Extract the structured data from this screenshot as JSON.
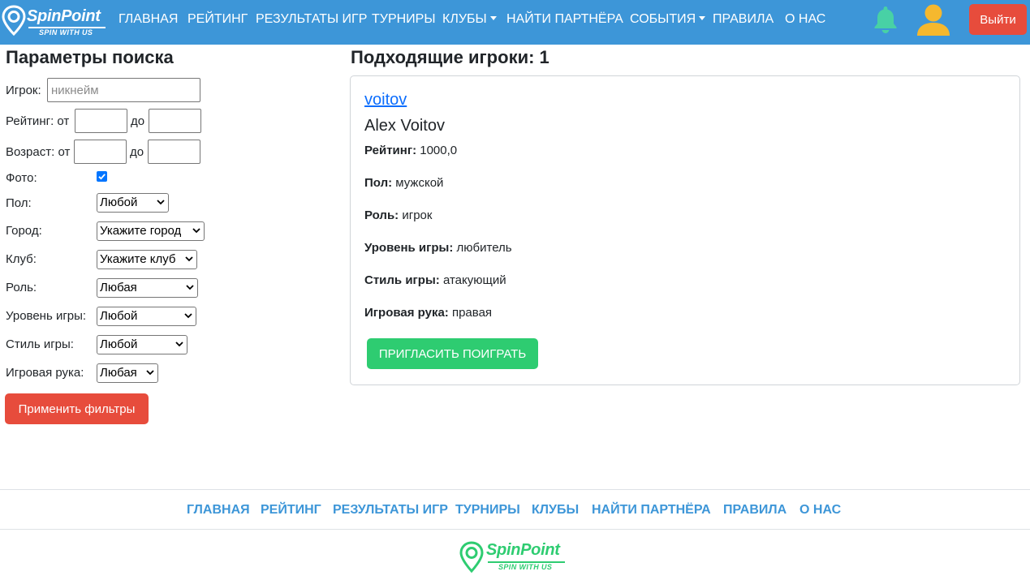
{
  "navbar": {
    "brand_name": "SpinPoint",
    "brand_tagline": "SPIN WITH US",
    "items": [
      {
        "label": "ГЛАВНАЯ"
      },
      {
        "label": "РЕЙТИНГ"
      },
      {
        "label": "РЕЗУЛЬТАТЫ ИГР"
      },
      {
        "label": "ТУРНИРЫ"
      },
      {
        "label": "КЛУБЫ"
      },
      {
        "label": "НАЙТИ ПАРТНЁРА"
      },
      {
        "label": "СОБЫТИЯ"
      },
      {
        "label": "ПРАВИЛА"
      },
      {
        "label": "О НАС"
      }
    ],
    "logout_label": "Выйти",
    "icons": {
      "notifications": "bell-icon",
      "profile": "user-avatar-icon"
    },
    "colors": {
      "background": "#3d96d8",
      "bell": "#48d1a5",
      "avatar": "#f5b82e",
      "logout": "#e74c3c"
    }
  },
  "filters": {
    "title": "Параметры поиска",
    "player_label": "Игрок:",
    "player_placeholder": "никнейм",
    "player_value": "",
    "rating_label": "Рейтинг: от",
    "rating_to_label": "до",
    "rating_from_value": "",
    "rating_to_value": "",
    "age_label": "Возраст: от",
    "age_to_label": "до",
    "age_from_value": "",
    "age_to_value": "",
    "photo_label": "Фото:",
    "photo_checked": true,
    "gender_label": "Пол:",
    "gender_value": "Любой",
    "city_label": "Город:",
    "city_value": "Укажите город",
    "club_label": "Клуб:",
    "club_value": "Укажите клуб",
    "role_label": "Роль:",
    "role_value": "Любая",
    "level_label": "Уровень игры:",
    "level_value": "Любой",
    "style_label": "Стиль игры:",
    "style_value": "Любой",
    "hand_label": "Игровая рука:",
    "hand_value": "Любая",
    "apply_label": "Применить фильтры"
  },
  "results": {
    "title": "Подходящие игроки: 1",
    "players": [
      {
        "username": "voitov",
        "full_name": "Alex Voitov",
        "rating_label": "Рейтинг:",
        "rating": "1000,0",
        "gender_label": "Пол:",
        "gender": "мужской",
        "role_label": "Роль:",
        "role": "игрок",
        "level_label": "Уровень игры:",
        "level": "любитель",
        "style_label": "Стиль игры:",
        "style": "атакующий",
        "hand_label": "Игровая рука:",
        "hand": "правая",
        "invite_label": "ПРИГЛАСИТЬ ПОИГРАТЬ"
      }
    ],
    "colors": {
      "invite": "#2ecc71",
      "username_link": "#0d6efd"
    }
  },
  "footer": {
    "links": [
      {
        "label": "ГЛАВНАЯ"
      },
      {
        "label": "РЕЙТИНГ"
      },
      {
        "label": "РЕЗУЛЬТАТЫ ИГР"
      },
      {
        "label": "ТУРНИРЫ"
      },
      {
        "label": "КЛУБЫ"
      },
      {
        "label": "НАЙТИ ПАРТНЁРА"
      },
      {
        "label": "ПРАВИЛА"
      },
      {
        "label": "О НАС"
      }
    ],
    "brand_name": "SpinPoint",
    "brand_tagline": "SPIN WITH US",
    "colors": {
      "links": "#3d96d8",
      "brand": "#2ecc71"
    }
  }
}
